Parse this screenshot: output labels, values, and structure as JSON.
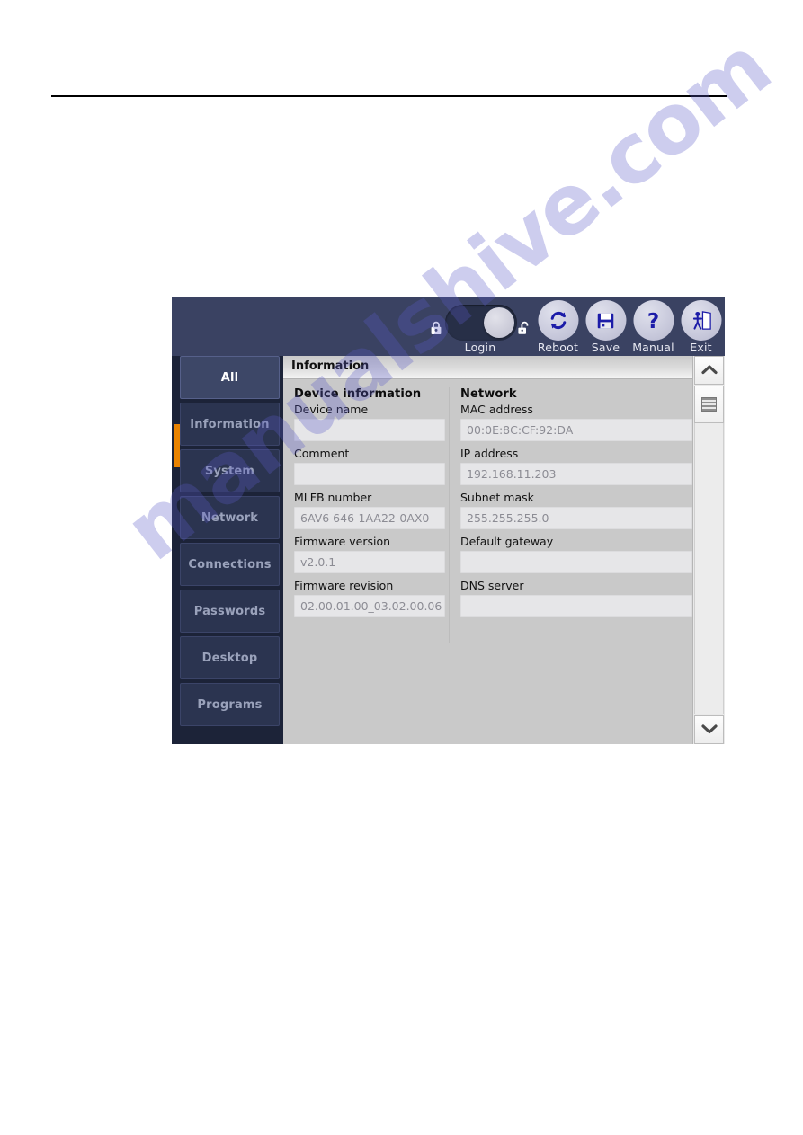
{
  "watermark": {
    "text": "manualshive.com"
  },
  "window": {
    "toolbar": {
      "login": {
        "label": "Login",
        "lock_closed_icon": "lock-closed-icon",
        "lock_open_icon": "lock-open-icon",
        "state": "unlocked"
      },
      "buttons": [
        {
          "label": "Reboot",
          "icon": "reboot-icon"
        },
        {
          "label": "Save",
          "icon": "save-floppy-icon"
        },
        {
          "label": "Manual",
          "icon": "question-mark-icon"
        },
        {
          "label": "Exit",
          "icon": "exit-door-icon"
        }
      ]
    },
    "sidebar": {
      "items": [
        {
          "label": "All",
          "selected": true
        },
        {
          "label": "Information",
          "selected": false
        },
        {
          "label": "System",
          "selected": false
        },
        {
          "label": "Network",
          "selected": false
        },
        {
          "label": "Connections",
          "selected": false
        },
        {
          "label": "Passwords",
          "selected": false
        },
        {
          "label": "Desktop",
          "selected": false
        },
        {
          "label": "Programs",
          "selected": false
        }
      ],
      "accent_color": "#e98300"
    },
    "content": {
      "title": "Information",
      "groups": [
        {
          "title": "Device information",
          "fields": [
            {
              "label": "Device name",
              "value": ""
            },
            {
              "label": "Comment",
              "value": ""
            },
            {
              "label": "MLFB number",
              "value": "6AV6 646-1AA22-0AX0"
            },
            {
              "label": "Firmware version",
              "value": "v2.0.1"
            },
            {
              "label": "Firmware revision",
              "value": "02.00.01.00_03.02.00.06"
            }
          ]
        },
        {
          "title": "Network",
          "fields": [
            {
              "label": "MAC address",
              "value": "00:0E:8C:CF:92:DA"
            },
            {
              "label": "IP address",
              "value": "192.168.11.203"
            },
            {
              "label": "Subnet mask",
              "value": "255.255.255.0"
            },
            {
              "label": "Default gateway",
              "value": ""
            },
            {
              "label": "DNS server",
              "value": ""
            }
          ]
        }
      ],
      "scrollbar": {
        "up_icon": "chevron-up-icon",
        "down_icon": "chevron-down-icon",
        "thumb_icon": "scroll-thumb-grip-icon"
      }
    }
  }
}
